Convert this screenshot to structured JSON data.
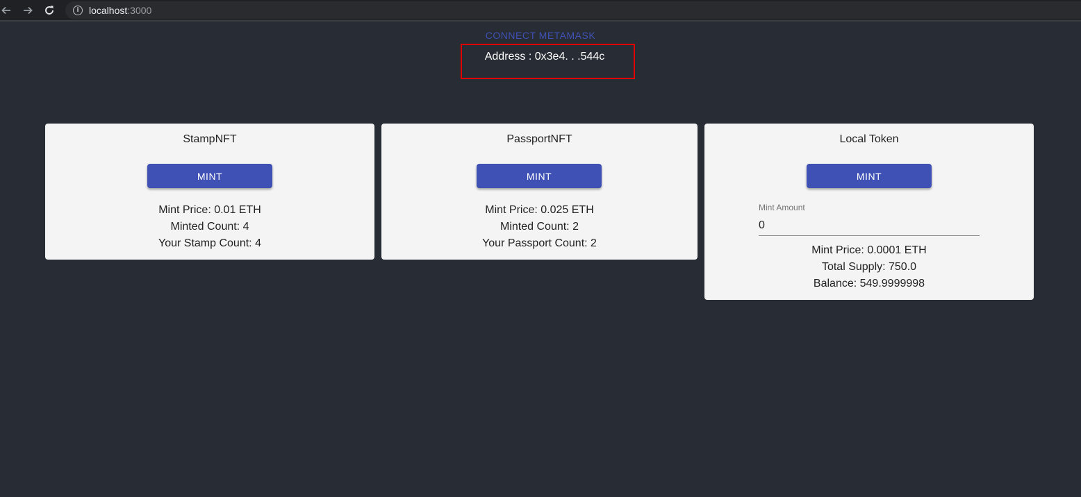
{
  "browser": {
    "url_host": "localhost",
    "url_port": ":3000"
  },
  "header": {
    "connect_label": "CONNECT METAMASK",
    "address_text": "Address : 0x3e4. . .544c"
  },
  "cards": {
    "stamp": {
      "title": "StampNFT",
      "mint_label": "MINT",
      "lines": [
        "Mint Price: 0.01 ETH",
        "Minted Count: 4",
        "Your Stamp Count: 4"
      ]
    },
    "passport": {
      "title": "PassportNFT",
      "mint_label": "MINT",
      "lines": [
        "Mint Price: 0.025 ETH",
        "Minted Count: 2",
        "Your Passport Count: 2"
      ]
    },
    "token": {
      "title": "Local Token",
      "mint_label": "MINT",
      "mint_amount_label": "Mint Amount",
      "mint_amount_value": "0",
      "lines": [
        "Mint Price: 0.0001 ETH",
        "Total Supply: 750.0",
        "Balance: 549.9999998"
      ]
    }
  },
  "colors": {
    "background": "#282c34",
    "primary": "#3f51b5",
    "card": "#f4f4f4",
    "highlight_border": "#e00000"
  }
}
